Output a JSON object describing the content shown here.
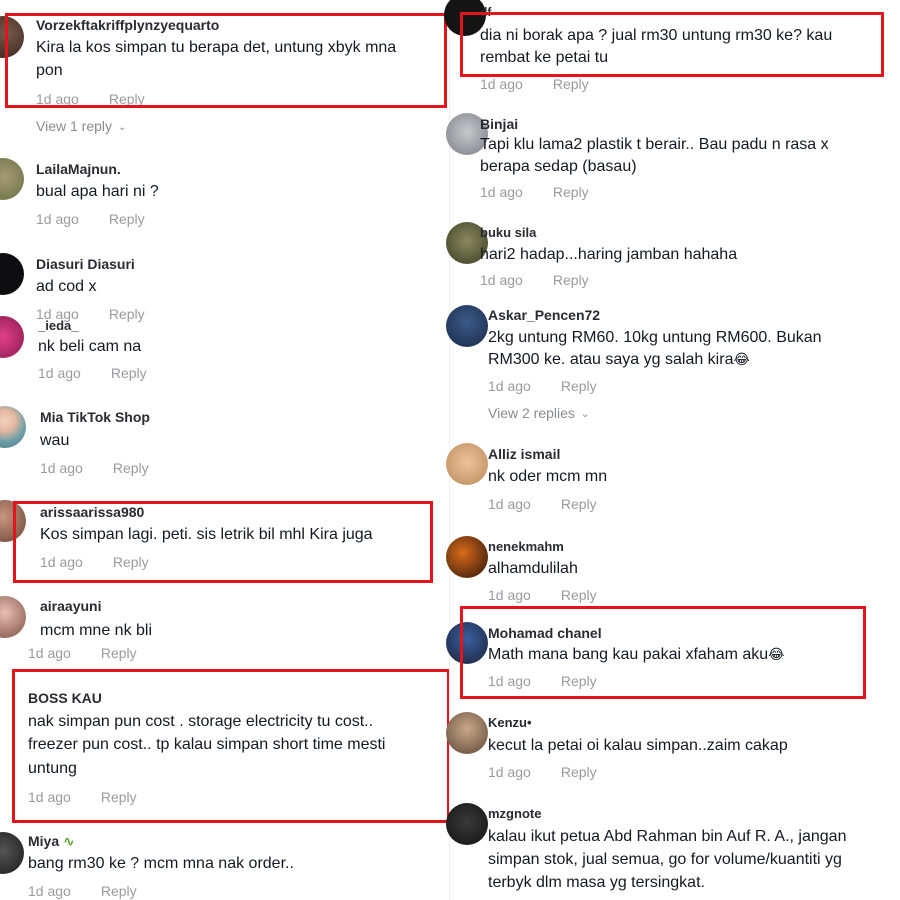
{
  "left_comments": [
    {
      "username": "Vorzekftakriffplynzyequarto",
      "lines": [
        "Kira la kos simpan tu berapa det, untung xbyk mna",
        "pon"
      ],
      "time": "1d ago",
      "reply": "Reply",
      "view_replies": "View 1 reply"
    },
    {
      "username": "LailaMajnun.",
      "lines": [
        "bual apa hari ni ?"
      ],
      "time": "1d ago",
      "reply": "Reply"
    },
    {
      "username": "Diasuri Diasuri",
      "lines": [
        "ad cod x"
      ],
      "time": "1d ago",
      "reply": "Reply"
    },
    {
      "username": "_ieda_",
      "lines": [
        "nk beli cam na"
      ],
      "time": "1d ago",
      "reply": "Reply"
    },
    {
      "username": "Mia TikTok Shop",
      "lines": [
        "wau"
      ],
      "time": "1d ago",
      "reply": "Reply"
    },
    {
      "username": "arissaarissa980",
      "lines": [
        "Kos simpan lagi. peti. sis letrik bil mhl Kira juga"
      ],
      "time": "1d ago",
      "reply": "Reply"
    },
    {
      "username": "airaayuni",
      "lines": [
        "mcm mne nk bli"
      ],
      "time": "1d ago",
      "reply": "Reply"
    },
    {
      "username": "BOSS KAU",
      "lines": [
        "nak simpan pun cost . storage electricity tu cost..",
        "freezer pun cost.. tp kalau simpan short time mesti",
        "untung"
      ],
      "time": "1d ago",
      "reply": "Reply"
    },
    {
      "username": "Miya",
      "lines": [
        "bang rm30 ke ? mcm mna nak order.."
      ],
      "time": "1d ago",
      "reply": "Reply"
    }
  ],
  "right_comments": [
    {
      "username": "df",
      "lines": [
        "dia ni borak apa ? jual rm30 untung rm30 ke? kau",
        "rembat ke petai tu"
      ],
      "time": "1d ago",
      "reply": "Reply"
    },
    {
      "username": "Binjai",
      "lines": [
        "Tapi klu lama2 plastik t berair.. Bau padu n rasa x",
        "berapa sedap (basau)"
      ],
      "time": "1d ago",
      "reply": "Reply"
    },
    {
      "username": "buku sila",
      "lines": [
        "hari2 hadap...haring jamban hahaha"
      ],
      "time": "1d ago",
      "reply": "Reply"
    },
    {
      "username": "Askar_Pencen72",
      "lines": [
        "2kg untung RM60. 10kg untung RM600. Bukan",
        "RM300 ke. atau saya yg salah kira"
      ],
      "time": "1d ago",
      "reply": "Reply",
      "view_replies": "View 2 replies"
    },
    {
      "username": "Alliz ismail",
      "lines": [
        "nk oder mcm mn"
      ],
      "time": "1d ago",
      "reply": "Reply"
    },
    {
      "username": "nenekmahm",
      "lines": [
        "alhamdulilah"
      ],
      "time": "1d ago",
      "reply": "Reply"
    },
    {
      "username": "Mohamad chanel",
      "lines": [
        "Math mana bang kau pakai xfaham aku"
      ],
      "time": "1d ago",
      "reply": "Reply"
    },
    {
      "username": "Kenzu•",
      "lines": [
        "kecut la petai oi kalau simpan..zaim cakap"
      ],
      "time": "1d ago",
      "reply": "Reply"
    },
    {
      "username": "mzgnote",
      "lines": [
        "kalau ikut petua Abd Rahman bin Auf R. A., jangan",
        "simpan stok, jual semua, go for volume/kuantiti yg",
        "terbyk dlm masa yg tersingkat."
      ]
    }
  ],
  "colors": {
    "highlight": "#e3141b",
    "meta": "#9a9aa0",
    "username": "#2a2a33",
    "text": "#161823"
  },
  "icons": {
    "chevron": "chevron-down-icon",
    "laugh": "face-with-tears-of-joy-icon",
    "snake": "snake-icon"
  }
}
